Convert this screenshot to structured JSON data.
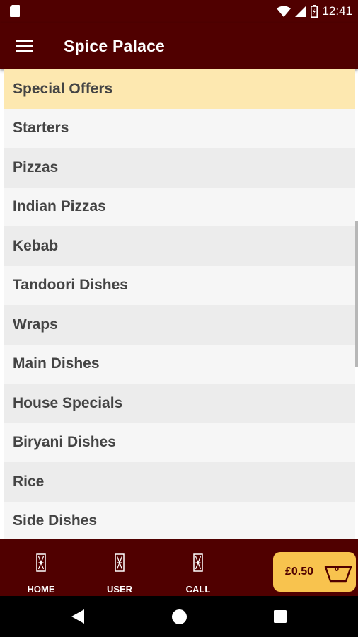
{
  "status_bar": {
    "time": "12:41",
    "icons": [
      "sd-card-icon",
      "wifi-icon",
      "signal-icon",
      "battery-icon"
    ]
  },
  "app_bar": {
    "title": "Spice Palace",
    "menu_icon": "hamburger-menu-icon"
  },
  "colors": {
    "brand": "#500000",
    "highlight": "#fde8b0",
    "row_even": "#f6f6f6",
    "row_odd": "#ececec",
    "cart_button": "#f8c34e"
  },
  "menu": {
    "items": [
      {
        "label": "Special Offers",
        "selected": true
      },
      {
        "label": "Starters"
      },
      {
        "label": "Pizzas"
      },
      {
        "label": "Indian Pizzas"
      },
      {
        "label": "Kebab"
      },
      {
        "label": "Tandoori Dishes"
      },
      {
        "label": "Wraps"
      },
      {
        "label": "Main Dishes"
      },
      {
        "label": "House Specials"
      },
      {
        "label": "Biryani Dishes"
      },
      {
        "label": "Rice"
      },
      {
        "label": "Side Dishes"
      }
    ]
  },
  "bottom_nav": {
    "items": [
      {
        "label": "HOME",
        "icon": "home-icon"
      },
      {
        "label": "USER",
        "icon": "user-icon"
      },
      {
        "label": "CALL",
        "icon": "call-icon"
      }
    ],
    "cart": {
      "price": "£0.50",
      "count": "0",
      "icon": "basket-icon"
    }
  },
  "system_nav": {
    "buttons": [
      "back-icon",
      "home-circle-icon",
      "recents-icon"
    ]
  }
}
